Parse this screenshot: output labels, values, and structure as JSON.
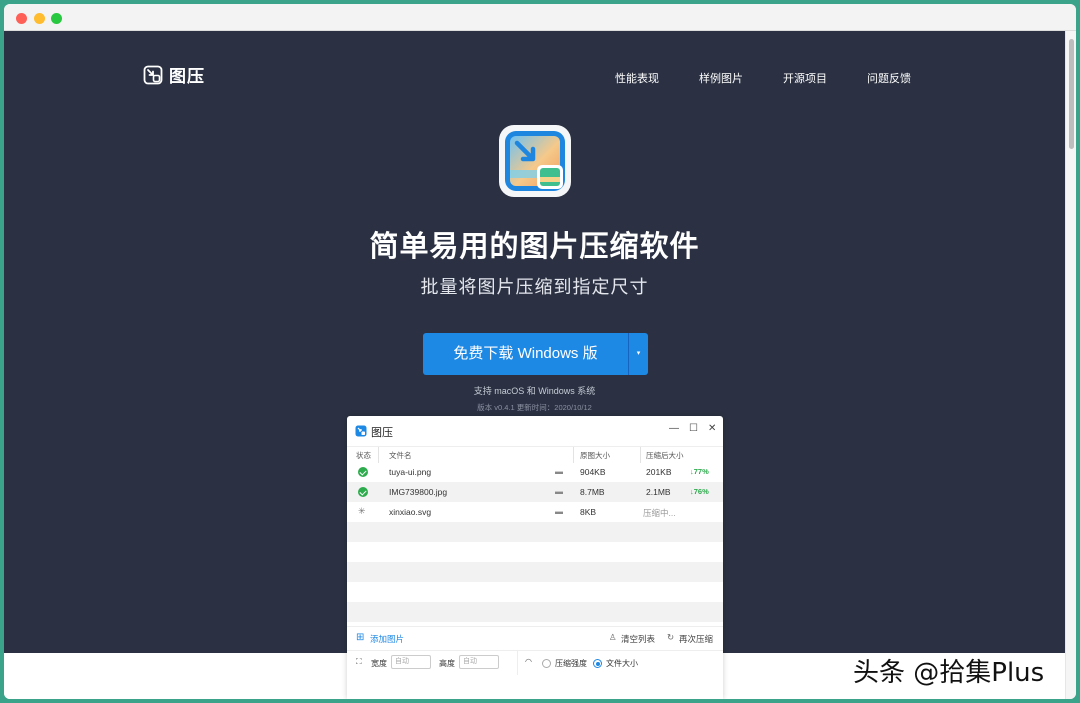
{
  "site": {
    "logo_text": "图压",
    "nav": [
      "性能表现",
      "样例图片",
      "开源项目",
      "问题反馈"
    ],
    "headline": "简单易用的图片压缩软件",
    "subheadline": "批量将图片压缩到指定尺寸",
    "download_label": "免费下载 Windows 版",
    "caret": "▾",
    "support_text": "支持 macOS 和 Windows 系统",
    "version_text": "版本 v0.4.1 更新时间：2020/10/12"
  },
  "app_window": {
    "title": "图压",
    "controls": {
      "minimize": "—",
      "maximize": "☐",
      "close": "✕"
    },
    "columns": {
      "status": "状态",
      "filename": "文件名",
      "original_size": "原图大小",
      "compressed_size": "压缩后大小"
    },
    "rows": [
      {
        "status": "done",
        "filename": "tuya-ui.png",
        "original_size": "904KB",
        "compressed_size": "201KB",
        "reduction": "↓77%"
      },
      {
        "status": "done",
        "filename": "IMG739800.jpg",
        "original_size": "8.7MB",
        "compressed_size": "2.1MB",
        "reduction": "↓76%"
      },
      {
        "status": "compressing",
        "filename": "xinxiao.svg",
        "original_size": "8KB",
        "compressed_size": "压缩中..."
      }
    ],
    "footer": {
      "add_images": "添加图片",
      "clear_list": "清空列表",
      "recompress": "再次压缩",
      "width_label": "宽度",
      "width_placeholder": "自动",
      "height_label": "高度",
      "height_placeholder": "自动",
      "mode_strength": "压缩强度",
      "mode_filesize": "文件大小",
      "selected_mode": "文件大小"
    }
  },
  "watermark": "头条 @拾集Plus",
  "colors": {
    "hero_bg": "#2b3142",
    "accent": "#1e88e5",
    "success": "#2eab4d",
    "frame": "#3aa38a"
  }
}
